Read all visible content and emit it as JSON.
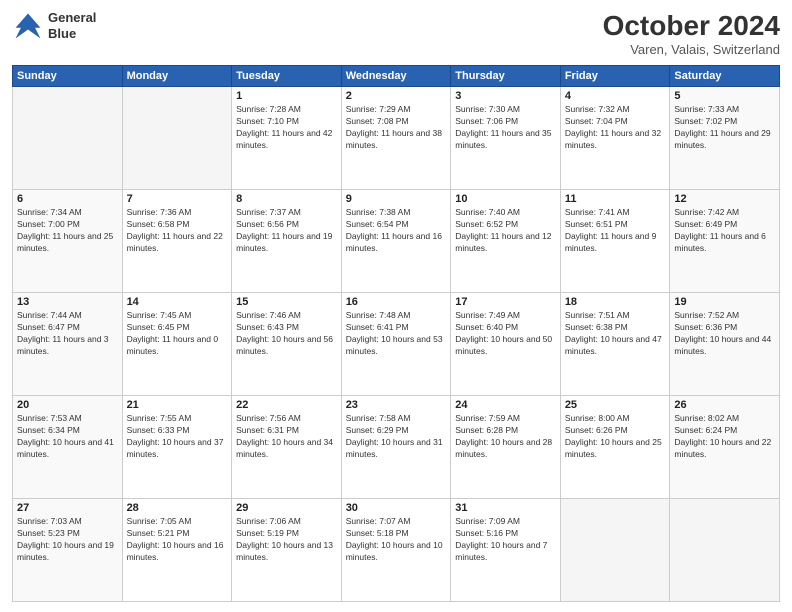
{
  "logo": {
    "line1": "General",
    "line2": "Blue"
  },
  "title": "October 2024",
  "location": "Varen, Valais, Switzerland",
  "days_of_week": [
    "Sunday",
    "Monday",
    "Tuesday",
    "Wednesday",
    "Thursday",
    "Friday",
    "Saturday"
  ],
  "weeks": [
    [
      {
        "num": "",
        "info": ""
      },
      {
        "num": "",
        "info": ""
      },
      {
        "num": "1",
        "info": "Sunrise: 7:28 AM\nSunset: 7:10 PM\nDaylight: 11 hours and 42 minutes."
      },
      {
        "num": "2",
        "info": "Sunrise: 7:29 AM\nSunset: 7:08 PM\nDaylight: 11 hours and 38 minutes."
      },
      {
        "num": "3",
        "info": "Sunrise: 7:30 AM\nSunset: 7:06 PM\nDaylight: 11 hours and 35 minutes."
      },
      {
        "num": "4",
        "info": "Sunrise: 7:32 AM\nSunset: 7:04 PM\nDaylight: 11 hours and 32 minutes."
      },
      {
        "num": "5",
        "info": "Sunrise: 7:33 AM\nSunset: 7:02 PM\nDaylight: 11 hours and 29 minutes."
      }
    ],
    [
      {
        "num": "6",
        "info": "Sunrise: 7:34 AM\nSunset: 7:00 PM\nDaylight: 11 hours and 25 minutes."
      },
      {
        "num": "7",
        "info": "Sunrise: 7:36 AM\nSunset: 6:58 PM\nDaylight: 11 hours and 22 minutes."
      },
      {
        "num": "8",
        "info": "Sunrise: 7:37 AM\nSunset: 6:56 PM\nDaylight: 11 hours and 19 minutes."
      },
      {
        "num": "9",
        "info": "Sunrise: 7:38 AM\nSunset: 6:54 PM\nDaylight: 11 hours and 16 minutes."
      },
      {
        "num": "10",
        "info": "Sunrise: 7:40 AM\nSunset: 6:52 PM\nDaylight: 11 hours and 12 minutes."
      },
      {
        "num": "11",
        "info": "Sunrise: 7:41 AM\nSunset: 6:51 PM\nDaylight: 11 hours and 9 minutes."
      },
      {
        "num": "12",
        "info": "Sunrise: 7:42 AM\nSunset: 6:49 PM\nDaylight: 11 hours and 6 minutes."
      }
    ],
    [
      {
        "num": "13",
        "info": "Sunrise: 7:44 AM\nSunset: 6:47 PM\nDaylight: 11 hours and 3 minutes."
      },
      {
        "num": "14",
        "info": "Sunrise: 7:45 AM\nSunset: 6:45 PM\nDaylight: 11 hours and 0 minutes."
      },
      {
        "num": "15",
        "info": "Sunrise: 7:46 AM\nSunset: 6:43 PM\nDaylight: 10 hours and 56 minutes."
      },
      {
        "num": "16",
        "info": "Sunrise: 7:48 AM\nSunset: 6:41 PM\nDaylight: 10 hours and 53 minutes."
      },
      {
        "num": "17",
        "info": "Sunrise: 7:49 AM\nSunset: 6:40 PM\nDaylight: 10 hours and 50 minutes."
      },
      {
        "num": "18",
        "info": "Sunrise: 7:51 AM\nSunset: 6:38 PM\nDaylight: 10 hours and 47 minutes."
      },
      {
        "num": "19",
        "info": "Sunrise: 7:52 AM\nSunset: 6:36 PM\nDaylight: 10 hours and 44 minutes."
      }
    ],
    [
      {
        "num": "20",
        "info": "Sunrise: 7:53 AM\nSunset: 6:34 PM\nDaylight: 10 hours and 41 minutes."
      },
      {
        "num": "21",
        "info": "Sunrise: 7:55 AM\nSunset: 6:33 PM\nDaylight: 10 hours and 37 minutes."
      },
      {
        "num": "22",
        "info": "Sunrise: 7:56 AM\nSunset: 6:31 PM\nDaylight: 10 hours and 34 minutes."
      },
      {
        "num": "23",
        "info": "Sunrise: 7:58 AM\nSunset: 6:29 PM\nDaylight: 10 hours and 31 minutes."
      },
      {
        "num": "24",
        "info": "Sunrise: 7:59 AM\nSunset: 6:28 PM\nDaylight: 10 hours and 28 minutes."
      },
      {
        "num": "25",
        "info": "Sunrise: 8:00 AM\nSunset: 6:26 PM\nDaylight: 10 hours and 25 minutes."
      },
      {
        "num": "26",
        "info": "Sunrise: 8:02 AM\nSunset: 6:24 PM\nDaylight: 10 hours and 22 minutes."
      }
    ],
    [
      {
        "num": "27",
        "info": "Sunrise: 7:03 AM\nSunset: 5:23 PM\nDaylight: 10 hours and 19 minutes."
      },
      {
        "num": "28",
        "info": "Sunrise: 7:05 AM\nSunset: 5:21 PM\nDaylight: 10 hours and 16 minutes."
      },
      {
        "num": "29",
        "info": "Sunrise: 7:06 AM\nSunset: 5:19 PM\nDaylight: 10 hours and 13 minutes."
      },
      {
        "num": "30",
        "info": "Sunrise: 7:07 AM\nSunset: 5:18 PM\nDaylight: 10 hours and 10 minutes."
      },
      {
        "num": "31",
        "info": "Sunrise: 7:09 AM\nSunset: 5:16 PM\nDaylight: 10 hours and 7 minutes."
      },
      {
        "num": "",
        "info": ""
      },
      {
        "num": "",
        "info": ""
      }
    ]
  ]
}
